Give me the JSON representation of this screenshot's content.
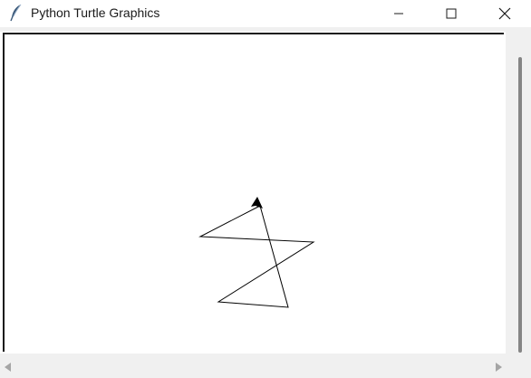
{
  "window": {
    "title": "Python Turtle Graphics",
    "icon": "feather-icon"
  },
  "controls": {
    "minimize": "minimize-icon",
    "maximize": "maximize-icon",
    "close": "close-icon"
  },
  "canvas": {
    "background": "#ffffff",
    "stroke_color": "#000000",
    "drawing": "five-pointed-star",
    "turtle_shape": "arrow"
  }
}
